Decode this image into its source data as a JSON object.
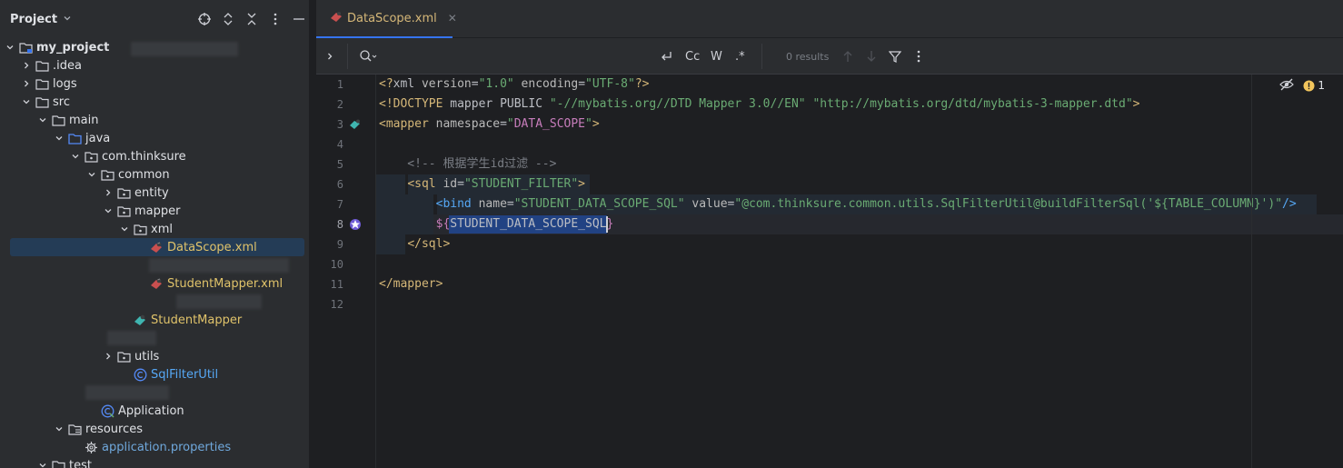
{
  "sidebar": {
    "title": "Project",
    "header_icons": [
      "crosshair-icon",
      "expand-icon",
      "collapse-icon",
      "more-icon",
      "minimize-icon"
    ],
    "tree": [
      {
        "depth": 0,
        "arrow": "down",
        "icon": "module-icon",
        "label": "my_project",
        "style": "bold"
      },
      {
        "depth": 1,
        "arrow": "right",
        "icon": "folder-icon",
        "label": ".idea"
      },
      {
        "depth": 1,
        "arrow": "right",
        "icon": "folder-icon",
        "label": "logs"
      },
      {
        "depth": 1,
        "arrow": "down",
        "icon": "folder-icon",
        "label": "src"
      },
      {
        "depth": 2,
        "arrow": "down",
        "icon": "folder-icon",
        "label": "main"
      },
      {
        "depth": 3,
        "arrow": "down",
        "icon": "source-folder-icon",
        "label": "java"
      },
      {
        "depth": 4,
        "arrow": "down",
        "icon": "package-icon",
        "label": "com.thinksure"
      },
      {
        "depth": 5,
        "arrow": "down",
        "icon": "package-icon",
        "label": "common"
      },
      {
        "depth": 6,
        "arrow": "right",
        "icon": "package-icon",
        "label": "entity"
      },
      {
        "depth": 6,
        "arrow": "down",
        "icon": "package-icon",
        "label": "mapper"
      },
      {
        "depth": 7,
        "arrow": "down",
        "icon": "package-icon",
        "label": "xml"
      },
      {
        "depth": 8,
        "arrow": "",
        "icon": "mybatis-xml-icon",
        "label": "DataScope.xml",
        "style": "yellow",
        "selected": true
      },
      {
        "depth": 8,
        "arrow": "",
        "icon": "blurred",
        "label": ""
      },
      {
        "depth": 8,
        "arrow": "",
        "icon": "mybatis-xml-icon",
        "label": "StudentMapper.xml",
        "style": "yellow"
      },
      {
        "depth": 8,
        "arrow": "",
        "icon": "blurred",
        "label": ""
      },
      {
        "depth": 7,
        "arrow": "",
        "icon": "mybatis-interface-icon",
        "label": "StudentMapper",
        "style": "yellow"
      },
      {
        "depth": 7,
        "arrow": "",
        "icon": "blurred",
        "label": ""
      },
      {
        "depth": 6,
        "arrow": "right",
        "icon": "package-icon",
        "label": "utils"
      },
      {
        "depth": 7,
        "arrow": "",
        "icon": "class-icon",
        "label": "SqlFilterUtil",
        "style": "teal"
      },
      {
        "depth": 5,
        "arrow": "",
        "icon": "blurred",
        "label": ""
      },
      {
        "depth": 5,
        "arrow": "",
        "icon": "spring-boot-icon",
        "label": "Application"
      },
      {
        "depth": 3,
        "arrow": "down",
        "icon": "resources-folder-icon",
        "label": "resources"
      },
      {
        "depth": 4,
        "arrow": "",
        "icon": "gear-icon",
        "label": "application.properties",
        "style": "blue"
      },
      {
        "depth": 2,
        "arrow": "down",
        "icon": "folder-icon",
        "label": "test"
      }
    ]
  },
  "editor": {
    "tab": {
      "label": "DataScope.xml",
      "close": "✕"
    },
    "find": {
      "results": "0 results",
      "case_label": "Cc",
      "word_label": "W",
      "regex_label": ".*"
    },
    "inspections": {
      "warnings": "1"
    },
    "line_numbers": [
      "1",
      "2",
      "3",
      "4",
      "5",
      "6",
      "7",
      "8",
      "9",
      "10",
      "11",
      "12"
    ],
    "lines": [
      [
        {
          "t": "<?",
          "c": "t-decl"
        },
        {
          "t": "xml ",
          "c": "t-plain"
        },
        {
          "t": "version",
          "c": "t-attr"
        },
        {
          "t": "=",
          "c": "t-plain"
        },
        {
          "t": "\"1.0\"",
          "c": "t-str"
        },
        {
          "t": " encoding",
          "c": "t-attr"
        },
        {
          "t": "=",
          "c": "t-plain"
        },
        {
          "t": "\"UTF-8\"",
          "c": "t-str"
        },
        {
          "t": "?>",
          "c": "t-decl"
        }
      ],
      [
        {
          "t": "<!DOCTYPE ",
          "c": "t-decl"
        },
        {
          "t": "mapper PUBLIC ",
          "c": "t-plain"
        },
        {
          "t": "\"-//mybatis.org//DTD Mapper 3.0//EN\"",
          "c": "t-str"
        },
        {
          "t": " ",
          "c": "t-plain"
        },
        {
          "t": "\"http://mybatis.org/dtd/mybatis-3-mapper.dtd\"",
          "c": "t-str"
        },
        {
          "t": ">",
          "c": "t-decl"
        }
      ],
      [
        {
          "t": "<mapper ",
          "c": "t-tag"
        },
        {
          "t": "namespace",
          "c": "t-attr"
        },
        {
          "t": "=",
          "c": "t-plain"
        },
        {
          "t": "\"",
          "c": "t-str"
        },
        {
          "t": "DATA_SCOPE",
          "c": "t-strong"
        },
        {
          "t": "\"",
          "c": "t-str"
        },
        {
          "t": ">",
          "c": "t-tag"
        }
      ],
      [],
      [
        {
          "t": "    <!-- 根据学生id过滤 -->",
          "c": "t-comment"
        }
      ],
      [
        {
          "t": "    ",
          "c": "t-plain"
        },
        {
          "t": "<sql ",
          "c": "t-tag"
        },
        {
          "t": "id",
          "c": "t-attr"
        },
        {
          "t": "=",
          "c": "t-plain"
        },
        {
          "t": "\"STUDENT_FILTER\"",
          "c": "t-str"
        },
        {
          "t": ">",
          "c": "t-tag"
        }
      ],
      [
        {
          "t": "        ",
          "c": "t-plain"
        },
        {
          "t": "<bind ",
          "c": "t-blue"
        },
        {
          "t": "name",
          "c": "t-attr"
        },
        {
          "t": "=",
          "c": "t-plain"
        },
        {
          "t": "\"STUDENT_DATA_SCOPE_SQL\"",
          "c": "t-str"
        },
        {
          "t": " value",
          "c": "t-attr"
        },
        {
          "t": "=",
          "c": "t-plain"
        },
        {
          "t": "\"@com.thinksure.common.utils.SqlFilterUtil@buildFilterSql('${TABLE_COLUMN}')\"",
          "c": "t-str"
        },
        {
          "t": "/>",
          "c": "t-blue"
        }
      ],
      [
        {
          "t": "        ",
          "c": "t-plain"
        },
        {
          "t": "${",
          "c": "t-strong"
        },
        {
          "t": "STUDENT_DATA_SCOPE_SQL",
          "c": "t-plain",
          "sel": true
        },
        {
          "t": "}",
          "c": "t-strong"
        }
      ],
      [
        {
          "t": "    ",
          "c": "t-plain"
        },
        {
          "t": "</sql>",
          "c": "t-tag"
        }
      ],
      [],
      [
        {
          "t": "</mapper>",
          "c": "t-tag"
        }
      ],
      []
    ]
  }
}
